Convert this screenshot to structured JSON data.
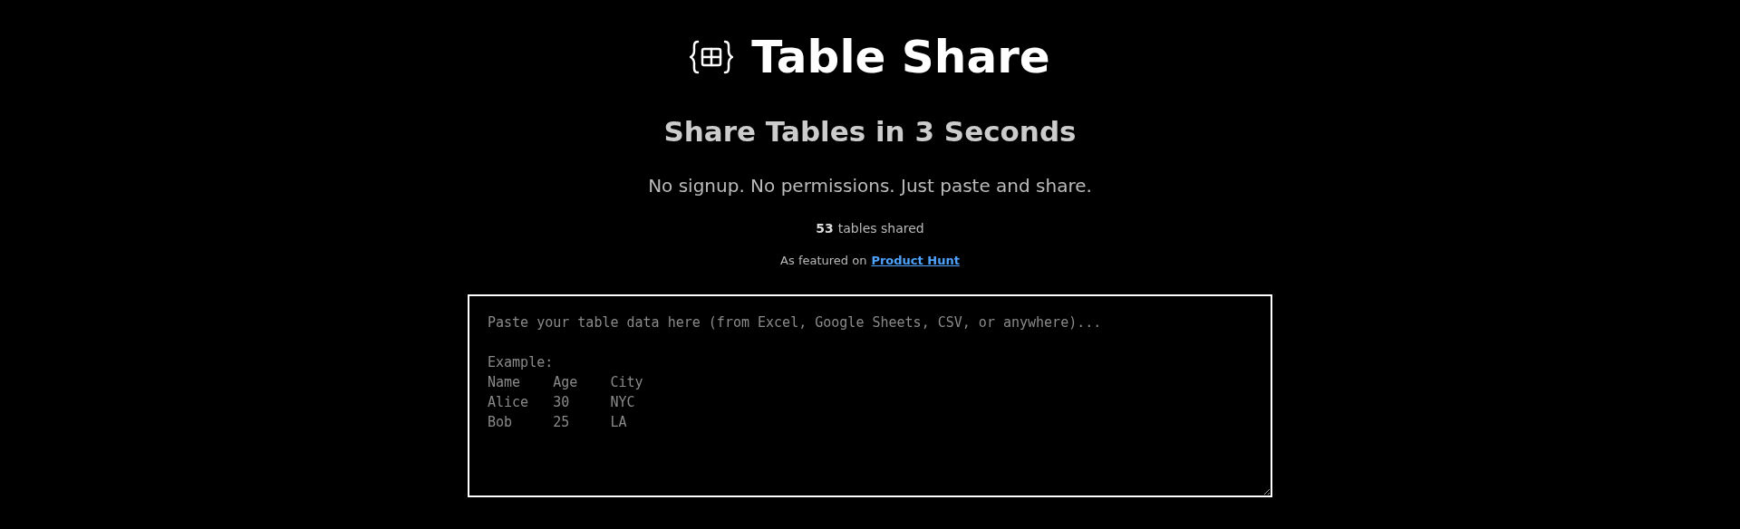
{
  "header": {
    "title": "Table Share"
  },
  "hero": {
    "headline": "Share Tables in 3 Seconds",
    "tagline": "No signup. No permissions. Just paste and share.",
    "counter": {
      "count": "53",
      "label": "tables shared"
    },
    "featured": {
      "prefix": "As featured on",
      "link": "Product Hunt"
    }
  },
  "editor": {
    "placeholder": "Paste your table data here (from Excel, Google Sheets, CSV, or anywhere)...\n\nExample:\nName    Age    City\nAlice   30     NYC\nBob     25     LA"
  }
}
